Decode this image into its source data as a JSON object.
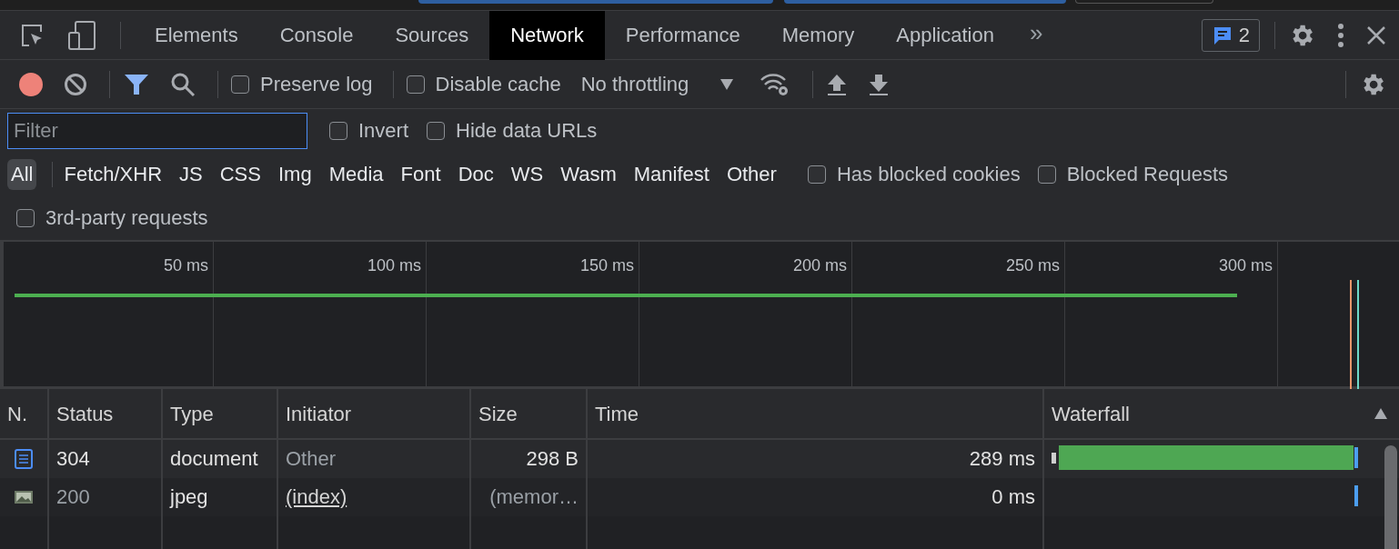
{
  "tabs": [
    {
      "label": "Elements",
      "selected": false
    },
    {
      "label": "Console",
      "selected": false
    },
    {
      "label": "Sources",
      "selected": false
    },
    {
      "label": "Network",
      "selected": true
    },
    {
      "label": "Performance",
      "selected": false
    },
    {
      "label": "Memory",
      "selected": false
    },
    {
      "label": "Application",
      "selected": false
    }
  ],
  "more_tabs": "»",
  "issues_badge": "2",
  "toolbar": {
    "recording": true,
    "preserve_log": {
      "label": "Preserve log",
      "checked": false
    },
    "disable_cache": {
      "label": "Disable cache",
      "checked": false
    },
    "throttling": "No throttling"
  },
  "filter": {
    "placeholder": "Filter",
    "options": [
      {
        "label": "Invert",
        "checked": false
      },
      {
        "label": "Hide data URLs",
        "checked": false
      }
    ]
  },
  "type_filters": [
    {
      "label": "All",
      "selected": true
    },
    {
      "label": "Fetch/XHR",
      "selected": false
    },
    {
      "label": "JS",
      "selected": false
    },
    {
      "label": "CSS",
      "selected": false
    },
    {
      "label": "Img",
      "selected": false
    },
    {
      "label": "Media",
      "selected": false
    },
    {
      "label": "Font",
      "selected": false
    },
    {
      "label": "Doc",
      "selected": false
    },
    {
      "label": "WS",
      "selected": false
    },
    {
      "label": "Wasm",
      "selected": false
    },
    {
      "label": "Manifest",
      "selected": false
    },
    {
      "label": "Other",
      "selected": false
    }
  ],
  "request_options": [
    {
      "label": "Has blocked cookies",
      "checked": false
    },
    {
      "label": "Blocked Requests",
      "checked": false
    },
    {
      "label": "3rd-party requests",
      "checked": false
    }
  ],
  "overview_ticks": [
    "50 ms",
    "100 ms",
    "150 ms",
    "200 ms",
    "250 ms",
    "300 ms"
  ],
  "table": {
    "columns": [
      "N.",
      "Status",
      "Type",
      "Initiator",
      "Size",
      "Time",
      "Waterfall"
    ],
    "rows": [
      {
        "kind": "document",
        "status": "304",
        "type": "document",
        "initiator": "Other",
        "initiator_link": false,
        "size": "298 B",
        "time": "289 ms",
        "cached": false
      },
      {
        "kind": "image",
        "status": "200",
        "type": "jpeg",
        "initiator": "(index)",
        "initiator_link": true,
        "size": "(memor…",
        "time": "0 ms",
        "cached": true
      }
    ]
  }
}
